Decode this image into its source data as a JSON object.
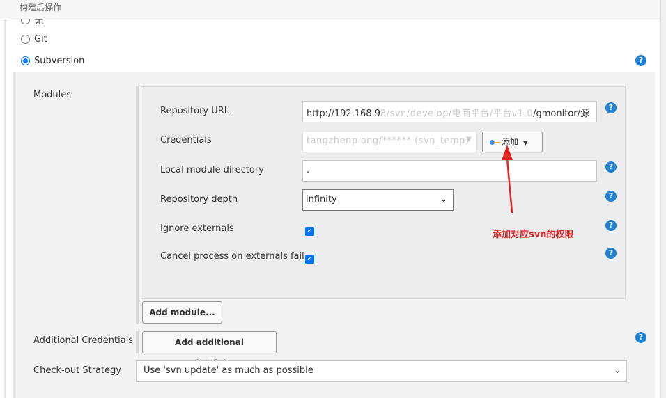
{
  "section_header": "构建后操作",
  "scm": {
    "options": [
      {
        "label": "无",
        "selected": false
      },
      {
        "label": "Git",
        "selected": false
      },
      {
        "label": "Subversion",
        "selected": true
      }
    ]
  },
  "modules": {
    "label": "Modules",
    "repository_url": {
      "label": "Repository URL",
      "prefix": "http://192.168.9",
      "blurred": "8/svn/develop/电商平台/平台v1.0",
      "suffix": "/gmonitor/源"
    },
    "credentials": {
      "label": "Credentials",
      "blurred_value": "tangzhenpiong/****** (svn_temp)",
      "add_label": "添加"
    },
    "local_module_directory": {
      "label": "Local module directory",
      "value": "."
    },
    "repository_depth": {
      "label": "Repository depth",
      "value": "infinity"
    },
    "ignore_externals": {
      "label": "Ignore externals",
      "checked": true
    },
    "cancel_process": {
      "label": "Cancel process on externals fail",
      "checked": true
    },
    "add_module_label": "Add module..."
  },
  "additional_credentials": {
    "label": "Additional Credentials",
    "button_label": "Add additional credentials..."
  },
  "checkout_strategy": {
    "label": "Check-out Strategy",
    "value": "Use 'svn update' as much as possible"
  },
  "annotation": {
    "text": "添加对应svn的权限",
    "color": "#e02424"
  },
  "icons": {
    "help": "?",
    "caret": "▼",
    "chevron": "⌄",
    "check": "✓",
    "key": "key-icon"
  },
  "colors": {
    "accent": "#0075ff",
    "help": "#1f82d2"
  }
}
